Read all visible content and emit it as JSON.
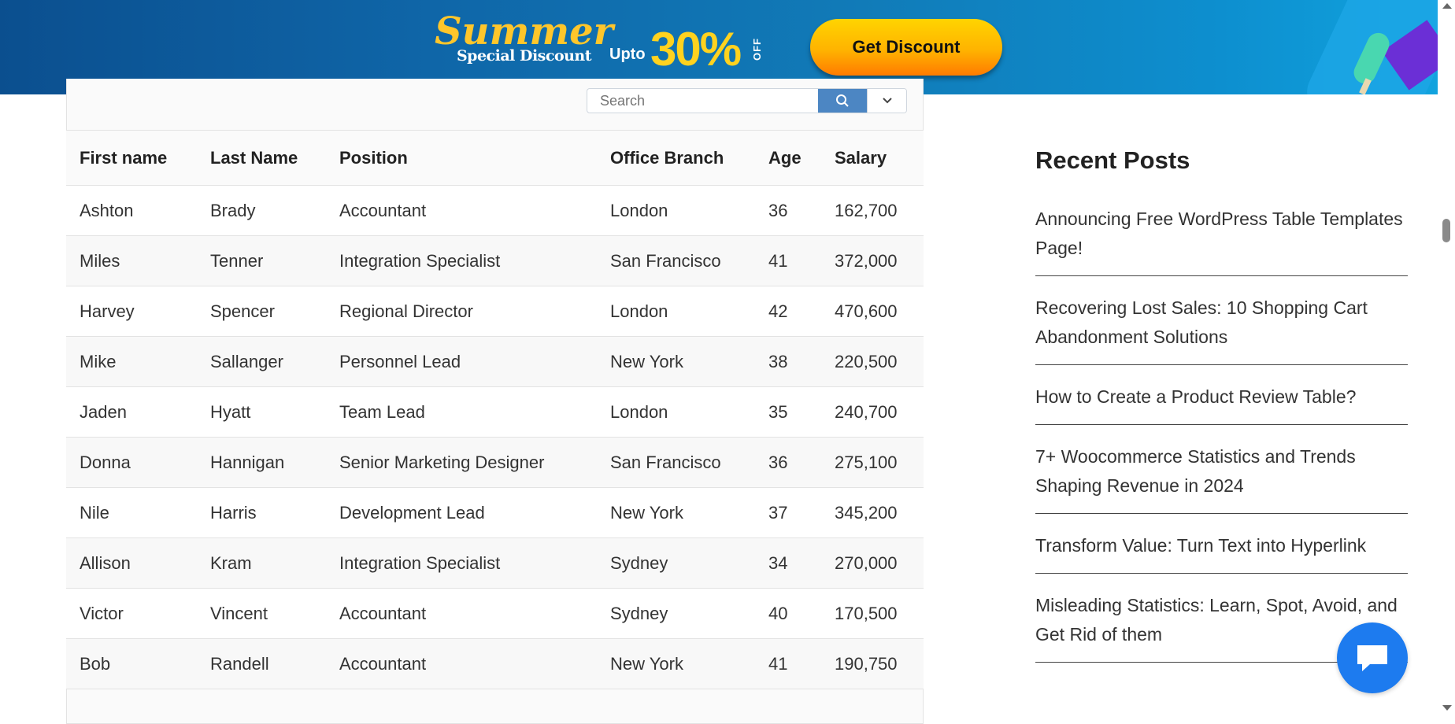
{
  "banner": {
    "title_main": "Summer",
    "title_sub": "Special Discount",
    "upto": "Upto",
    "percent": "30%",
    "off": "OFF",
    "cta_label": "Get Discount"
  },
  "search": {
    "placeholder": "Search"
  },
  "table": {
    "headers": [
      "First name",
      "Last Name",
      "Position",
      "Office Branch",
      "Age",
      "Salary"
    ],
    "rows": [
      [
        "Ashton",
        "Brady",
        "Accountant",
        "London",
        "36",
        "162,700"
      ],
      [
        "Miles",
        "Tenner",
        "Integration Specialist",
        "San Francisco",
        "41",
        "372,000"
      ],
      [
        "Harvey",
        "Spencer",
        "Regional Director",
        "London",
        "42",
        "470,600"
      ],
      [
        "Mike",
        "Sallanger",
        "Personnel Lead",
        "New York",
        "38",
        "220,500"
      ],
      [
        "Jaden",
        "Hyatt",
        "Team Lead",
        "London",
        "35",
        "240,700"
      ],
      [
        "Donna",
        "Hannigan",
        "Senior Marketing Designer",
        "San Francisco",
        "36",
        "275,100"
      ],
      [
        "Nile",
        "Harris",
        "Development Lead",
        "New York",
        "37",
        "345,200"
      ],
      [
        "Allison",
        "Kram",
        "Integration Specialist",
        "Sydney",
        "34",
        "270,000"
      ],
      [
        "Victor",
        "Vincent",
        "Accountant",
        "Sydney",
        "40",
        "170,500"
      ],
      [
        "Bob",
        "Randell",
        "Accountant",
        "New York",
        "41",
        "190,750"
      ]
    ]
  },
  "sidebar": {
    "heading": "Recent Posts",
    "posts": [
      "Announcing Free WordPress Table Templates Page!",
      "Recovering Lost Sales: 10 Shopping Cart Abandonment Solutions",
      "How to Create a Product Review Table?",
      "7+ Woocommerce Statistics and Trends Shaping Revenue in 2024",
      "Transform Value: Turn Text into Hyperlink",
      "Misleading Statistics: Learn, Spot, Avoid, and Get Rid of them"
    ]
  },
  "icons": {
    "search": "search-icon",
    "dropdown": "chevron-down-icon",
    "chat": "chat-icon"
  },
  "colors": {
    "cta_gradient_top": "#ffd400",
    "cta_gradient_bottom": "#ff7b00",
    "search_button": "#4c86c3",
    "chat_button": "#1d7bef",
    "accent_yellow": "#ffc62b"
  }
}
